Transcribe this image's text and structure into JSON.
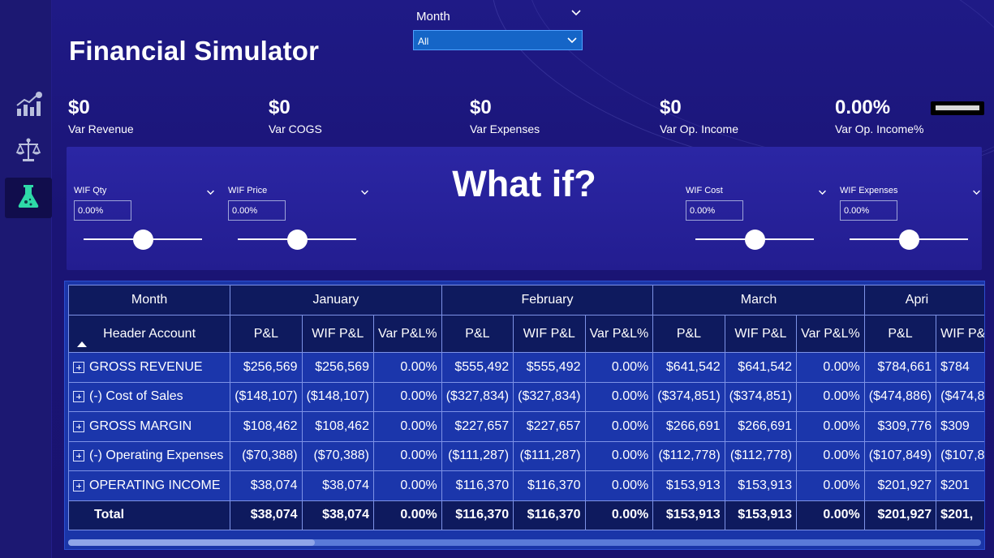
{
  "app": {
    "title": "Financial Simulator"
  },
  "sidebar": {
    "items": [
      {
        "icon": "chart-growth-icon"
      },
      {
        "icon": "scales-icon"
      },
      {
        "icon": "flask-icon"
      }
    ]
  },
  "month_slicer": {
    "label": "Month",
    "selected": "All"
  },
  "kpis": [
    {
      "value": "$0",
      "label": "Var Revenue"
    },
    {
      "value": "$0",
      "label": "Var COGS"
    },
    {
      "value": "$0",
      "label": "Var Expenses"
    },
    {
      "value": "$0",
      "label": "Var Op. Income"
    },
    {
      "value": "0.00%",
      "label": "Var Op. Income%"
    }
  ],
  "whatif": {
    "title": "What if?",
    "params": [
      {
        "label": "WIF Qty",
        "value": "0.00%",
        "slider_fraction": 0.5
      },
      {
        "label": "WIF Price",
        "value": "0.00%",
        "slider_fraction": 0.5
      },
      {
        "label": "WIF Cost",
        "value": "0.00%",
        "slider_fraction": 0.5
      },
      {
        "label": "WIF Expenses",
        "value": "0.00%",
        "slider_fraction": 0.5
      }
    ]
  },
  "table": {
    "month_header": "Month",
    "row_header": "Header Account",
    "months": [
      "January",
      "February",
      "March",
      "Apri"
    ],
    "subcols": [
      "P&L",
      "WIF P&L",
      "Var P&L%"
    ],
    "rows": [
      {
        "name": "GROSS REVENUE",
        "cells": [
          "$256,569",
          "$256,569",
          "0.00%",
          "$555,492",
          "$555,492",
          "0.00%",
          "$641,542",
          "$641,542",
          "0.00%",
          "$784,661",
          "$784"
        ]
      },
      {
        "name": "(-) Cost of Sales",
        "cells": [
          "($148,107)",
          "($148,107)",
          "0.00%",
          "($327,834)",
          "($327,834)",
          "0.00%",
          "($374,851)",
          "($374,851)",
          "0.00%",
          "($474,886)",
          "($474,8"
        ]
      },
      {
        "name": "GROSS MARGIN",
        "cells": [
          "$108,462",
          "$108,462",
          "0.00%",
          "$227,657",
          "$227,657",
          "0.00%",
          "$266,691",
          "$266,691",
          "0.00%",
          "$309,776",
          "$309"
        ]
      },
      {
        "name": "(-) Operating Expenses",
        "cells": [
          "($70,388)",
          "($70,388)",
          "0.00%",
          "($111,287)",
          "($111,287)",
          "0.00%",
          "($112,778)",
          "($112,778)",
          "0.00%",
          "($107,849)",
          "($107,8"
        ]
      },
      {
        "name": "OPERATING INCOME",
        "cells": [
          "$38,074",
          "$38,074",
          "0.00%",
          "$116,370",
          "$116,370",
          "0.00%",
          "$153,913",
          "$153,913",
          "0.00%",
          "$201,927",
          "$201"
        ]
      }
    ],
    "total": {
      "name": "Total",
      "cells": [
        "$38,074",
        "$38,074",
        "0.00%",
        "$116,370",
        "$116,370",
        "0.00%",
        "$153,913",
        "$153,913",
        "0.00%",
        "$201,927",
        "$201,"
      ]
    },
    "scroll_fraction": 0.27
  },
  "colors": {
    "background": "#1a1475",
    "panel": "#2b26a4",
    "table_body": "#1b36ab",
    "table_header": "#0e1a5e",
    "slicer": "#1565c7",
    "accent_icon": "#2ed9a8"
  }
}
